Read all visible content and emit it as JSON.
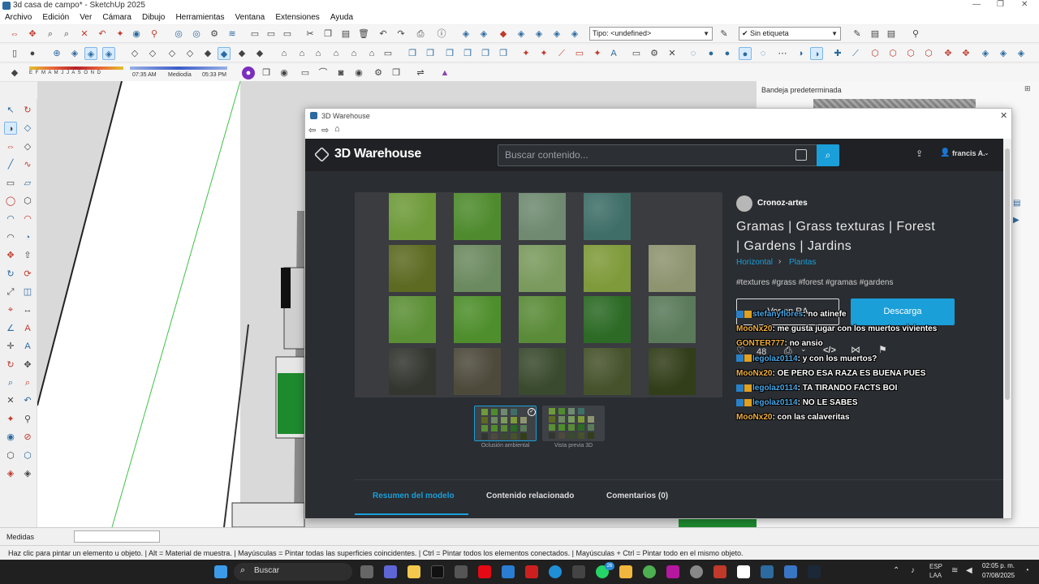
{
  "window": {
    "title": "3d casa de campo* - SketchUp 2025"
  },
  "menu": {
    "items": [
      "Archivo",
      "Edición",
      "Ver",
      "Cámara",
      "Dibujo",
      "Herramientas",
      "Ventana",
      "Extensiones",
      "Ayuda"
    ]
  },
  "toolbar": {
    "tipo_select": "Tipo: <undefined>",
    "etiqueta_select": "Sin etiqueta",
    "months": "E F M A M J J A S O N D",
    "time_start": "07:35 AM",
    "time_mid": "Mediodía",
    "time_end": "05:33 PM"
  },
  "tray": {
    "title": "Bandeja predeterminada"
  },
  "warehouse": {
    "window_title": "3D Warehouse",
    "logo": "3D Warehouse",
    "search_placeholder": "Buscar contenido...",
    "user": "francis A.",
    "author": "Cronoz-artes",
    "model_title_line1": "Gramas | Grass texturas | Forest",
    "model_title_line2": "| Gardens | Jardins",
    "breadcrumb_1": "Horizontal",
    "breadcrumb_2": "Plantas",
    "tags": "#textures #grass #forest #gramas #gardens",
    "btn_ar": "Ver en RA",
    "btn_download": "Descarga",
    "likes": "48",
    "thumb1_label": "Oclusión ambiental",
    "thumb2_label": "Vista previa 3D",
    "tabs": [
      "Resumen del modelo",
      "Contenido relacionado",
      "Comentarios (0)"
    ],
    "swatch_colors": [
      [
        "#6e9a3a",
        "#4f8b2e",
        "#6f8a70",
        "#3f6e68",
        ""
      ],
      [
        "#5d6a22",
        "#6c8a60",
        "#7a9a5e",
        "#7f9a3a",
        "#8e9470"
      ],
      [
        "#5b8f35",
        "#4e8e2c",
        "#5a8b38",
        "#2c6a25",
        "#5a7a5a"
      ],
      [
        "#33362f",
        "#4d4a3c",
        "#3a4a2e",
        "#46522c",
        "#323e1a"
      ]
    ]
  },
  "chat": [
    {
      "user": "stefanyflores",
      "msg": ": no atinefe",
      "cls": "u2",
      "badge": true
    },
    {
      "user": "MooNx20",
      "msg": ": me gusta jugar con los muertos vivientes",
      "cls": "u1",
      "badge": false
    },
    {
      "user": "GONTER777",
      "msg": ": no ansio",
      "cls": "u1",
      "badge": false
    },
    {
      "user": "legolaz0114",
      "msg": ": y con los muertos?",
      "cls": "u2",
      "badge": true
    },
    {
      "user": "MooNx20",
      "msg": ": OE PERO ESA RAZA ES BUENA PUES",
      "cls": "u1",
      "badge": false
    },
    {
      "user": "legolaz0114",
      "msg": ": TA TIRANDO FACTS BOI",
      "cls": "u2",
      "badge": true
    },
    {
      "user": "legolaz0114",
      "msg": ": NO LE SABES",
      "cls": "u2",
      "badge": true
    },
    {
      "user": "MooNx20",
      "msg": ": con las calaveritas",
      "cls": "u1",
      "badge": false
    }
  ],
  "measurements": {
    "label": "Medidas"
  },
  "status": {
    "text": "Haz clic para pintar un elemento u objeto. | Alt = Material de muestra. | Mayúsculas = Pintar todas las superficies coincidentes. | Ctrl = Pintar todos los elementos conectados. | Mayúsculas + Ctrl = Pintar todo en el mismo objeto."
  },
  "taskbar": {
    "search": "Buscar",
    "lang": "ESP",
    "lang2": "LAA",
    "time": "02:05 p. m.",
    "date": "07/08/2025",
    "whatsapp_badge": "26"
  }
}
